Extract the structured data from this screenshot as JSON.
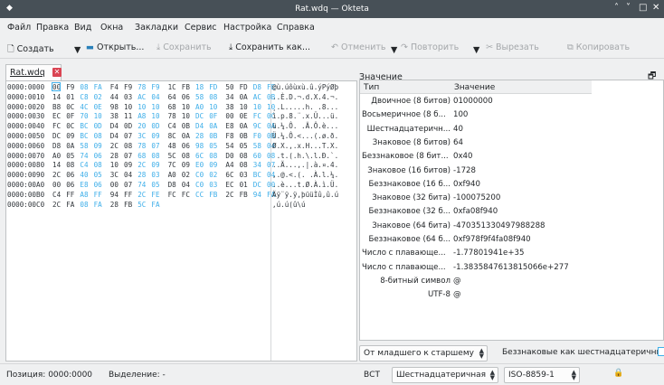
{
  "titlebar": {
    "title": "Rat.wdq — Okteta",
    "app_icon": "okteta-icon",
    "buttons": [
      "˄",
      "˅",
      "□",
      "✕"
    ]
  },
  "menu": [
    "Файл",
    "Правка",
    "Вид",
    "Окна",
    "Закладки",
    "Сервис",
    "Настройка",
    "Справка"
  ],
  "toolbar": {
    "new": "Создать",
    "open": "Открыть...",
    "save": "Сохранить",
    "save_as": "Сохранить как...",
    "undo": "Отменить",
    "redo": "Повторить",
    "cut": "Вырезать",
    "copy": "Копировать"
  },
  "document": {
    "tab_label": "Rat.wdq",
    "rows": [
      {
        "offset": "0000:0000",
        "bytes": [
          "00",
          "F9",
          "08",
          "FA",
          "F4",
          "F9",
          "78",
          "F9",
          "1C",
          "FB",
          "18",
          "FD",
          "50",
          "FD",
          "D8",
          "FE"
        ],
        "text": "@ù.úôùxù.û.ýPýØþ"
      },
      {
        "offset": "0000:0010",
        "bytes": [
          "14",
          "01",
          "C8",
          "02",
          "44",
          "03",
          "AC",
          "04",
          "64",
          "06",
          "58",
          "08",
          "34",
          "0A",
          "AC",
          "0B"
        ],
        "text": "..È.D.¬.d.X.4.¬."
      },
      {
        "offset": "0000:0020",
        "bytes": [
          "B8",
          "0C",
          "4C",
          "0E",
          "98",
          "10",
          "10",
          "10",
          "68",
          "10",
          "A0",
          "10",
          "38",
          "10",
          "10",
          "10"
        ],
        "text": "¸.L.....h. .8..."
      },
      {
        "offset": "0000:0030",
        "bytes": [
          "EC",
          "0F",
          "70",
          "10",
          "38",
          "11",
          "A8",
          "10",
          "78",
          "10",
          "DC",
          "0F",
          "00",
          "0E",
          "FC",
          "0C"
        ],
        "text": "ì.p.8.¨.x.Ü...ü."
      },
      {
        "offset": "0000:0040",
        "bytes": [
          "FC",
          "0C",
          "BC",
          "0D",
          "D4",
          "0D",
          "20",
          "0D",
          "C4",
          "0B",
          "D4",
          "0A",
          "E8",
          "0A",
          "9C",
          "0A"
        ],
        "text": "ü.¼.Ô. .Ä.Ô.è..."
      },
      {
        "offset": "0000:0050",
        "bytes": [
          "DC",
          "09",
          "BC",
          "08",
          "D4",
          "07",
          "3C",
          "09",
          "8C",
          "0A",
          "28",
          "0B",
          "F8",
          "0B",
          "F0",
          "0B"
        ],
        "text": "Ü.¼.Ô.<...(.ø.ð."
      },
      {
        "offset": "0000:0060",
        "bytes": [
          "D8",
          "0A",
          "58",
          "09",
          "2C",
          "08",
          "78",
          "07",
          "48",
          "06",
          "98",
          "05",
          "54",
          "05",
          "58",
          "04"
        ],
        "text": "Ø.X.,.x.H...T.X."
      },
      {
        "offset": "0000:0070",
        "bytes": [
          "A0",
          "05",
          "74",
          "06",
          "28",
          "07",
          "68",
          "08",
          "5C",
          "08",
          "6C",
          "08",
          "D0",
          "08",
          "60",
          "08"
        ],
        "text": " .t.(.h.\\.l.Ð.`."
      },
      {
        "offset": "0000:0080",
        "bytes": [
          "14",
          "08",
          "C4",
          "08",
          "10",
          "09",
          "2C",
          "09",
          "7C",
          "09",
          "E0",
          "09",
          "A4",
          "08",
          "34",
          "07"
        ],
        "text": "..Ä...,.|.à.¤.4."
      },
      {
        "offset": "0000:0090",
        "bytes": [
          "2C",
          "06",
          "40",
          "05",
          "3C",
          "04",
          "28",
          "03",
          "A0",
          "02",
          "C0",
          "02",
          "6C",
          "03",
          "BC",
          "04"
        ],
        "text": ",.@.<.(. .À.l.¼."
      },
      {
        "offset": "0000:00A0",
        "bytes": [
          "00",
          "06",
          "E8",
          "06",
          "00",
          "07",
          "74",
          "05",
          "D8",
          "04",
          "C0",
          "03",
          "EC",
          "01",
          "DC",
          "00"
        ],
        "text": "..è...t.Ø.À.ì.Ü."
      },
      {
        "offset": "0000:00B0",
        "bytes": [
          "C4",
          "FF",
          "A8",
          "FF",
          "94",
          "FF",
          "2C",
          "FE",
          "FC",
          "FC",
          "CC",
          "FB",
          "2C",
          "FB",
          "94",
          "FA"
        ],
        "text": "Äÿ¨ÿ.ÿ,þüüÌû,û.ú"
      },
      {
        "offset": "0000:00C0",
        "bytes": [
          "2C",
          "FA",
          "08",
          "FA",
          "28",
          "FB",
          "5C",
          "FA"
        ],
        "text": ",ú.ú(û\\ú"
      }
    ]
  },
  "decoder": {
    "panel_title": "Значение",
    "col_type": "Тип",
    "col_value": "Значение",
    "rows": [
      {
        "type": "Двоичное (8 битов)",
        "value": "01000000"
      },
      {
        "type": "Восьмеричное (8 б...",
        "value": "100"
      },
      {
        "type": "Шестнадцатеричн...",
        "value": "40"
      },
      {
        "type": "Знаковое (8 битов)",
        "value": "64"
      },
      {
        "type": "Беззнаковое (8 бит...",
        "value": "0x40"
      },
      {
        "type": "Знаковое (16 битов)",
        "value": "-1728"
      },
      {
        "type": "Беззнаковое (16 б...",
        "value": "0xf940"
      },
      {
        "type": "Знаковое (32 бита)",
        "value": "-100075200"
      },
      {
        "type": "Беззнаковое (32 б...",
        "value": "0xfa08f940"
      },
      {
        "type": "Знаковое (64 бита)",
        "value": "-470351330497988288"
      },
      {
        "type": "Беззнаковое (64 б...",
        "value": "0xf978f9f4fa08f940"
      },
      {
        "type": "Число с плавающе...",
        "value": "-1.77801941e+35"
      },
      {
        "type": "Число с плавающе...",
        "value": "-1.3835847613815066e+277"
      },
      {
        "type": "8-битный символ",
        "value": "@"
      },
      {
        "type": "UTF-8",
        "value": "@"
      }
    ],
    "byte_order": "От младшего к старшему",
    "hex_unsigned_label": "Беззнаковые как шестнадцатеричные:"
  },
  "status": {
    "position": "Позиция: 0000:0000",
    "selection": "Выделение: -",
    "mode": "ВСТ",
    "encoding_view": "Шестнадцатеричная",
    "charset": "ISO-8859-1",
    "lock_icon": "lock-icon"
  }
}
